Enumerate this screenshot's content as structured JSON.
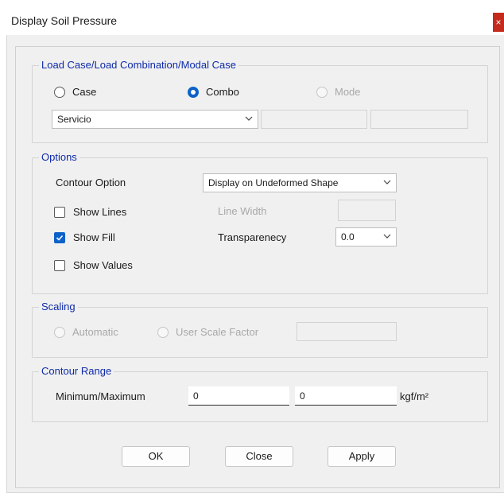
{
  "window": {
    "title": "Display Soil Pressure",
    "close_glyph": "×"
  },
  "load_case": {
    "legend": "Load Case/Load Combination/Modal Case",
    "radio_case": "Case",
    "radio_combo": "Combo",
    "radio_mode": "Mode",
    "selected": "Combo",
    "selected_value": "Servicio"
  },
  "options": {
    "legend": "Options",
    "contour_option_label": "Contour Option",
    "contour_option_value": "Display on Undeformed Shape",
    "show_lines": {
      "label": "Show Lines",
      "checked": false
    },
    "show_fill": {
      "label": "Show Fill",
      "checked": true
    },
    "show_values": {
      "label": "Show Values",
      "checked": false
    },
    "line_width_label": "Line Width",
    "transparency_label": "Transparenecy",
    "transparency_value": "0.0"
  },
  "scaling": {
    "legend": "Scaling",
    "automatic": "Automatic",
    "user_scale_factor": "User Scale Factor"
  },
  "contour_range": {
    "legend": "Contour Range",
    "minmax_label": "Minimum/Maximum",
    "minimum": "0",
    "maximum": "0",
    "units": "kgf/m²"
  },
  "buttons": {
    "ok": "OK",
    "close": "Close",
    "apply": "Apply"
  },
  "icons": {
    "chevron": "chevron-down-icon",
    "check": "check-icon"
  },
  "colors": {
    "accent": "#0c62c8",
    "legend": "#0e2aa9",
    "close": "#c42b1c"
  }
}
